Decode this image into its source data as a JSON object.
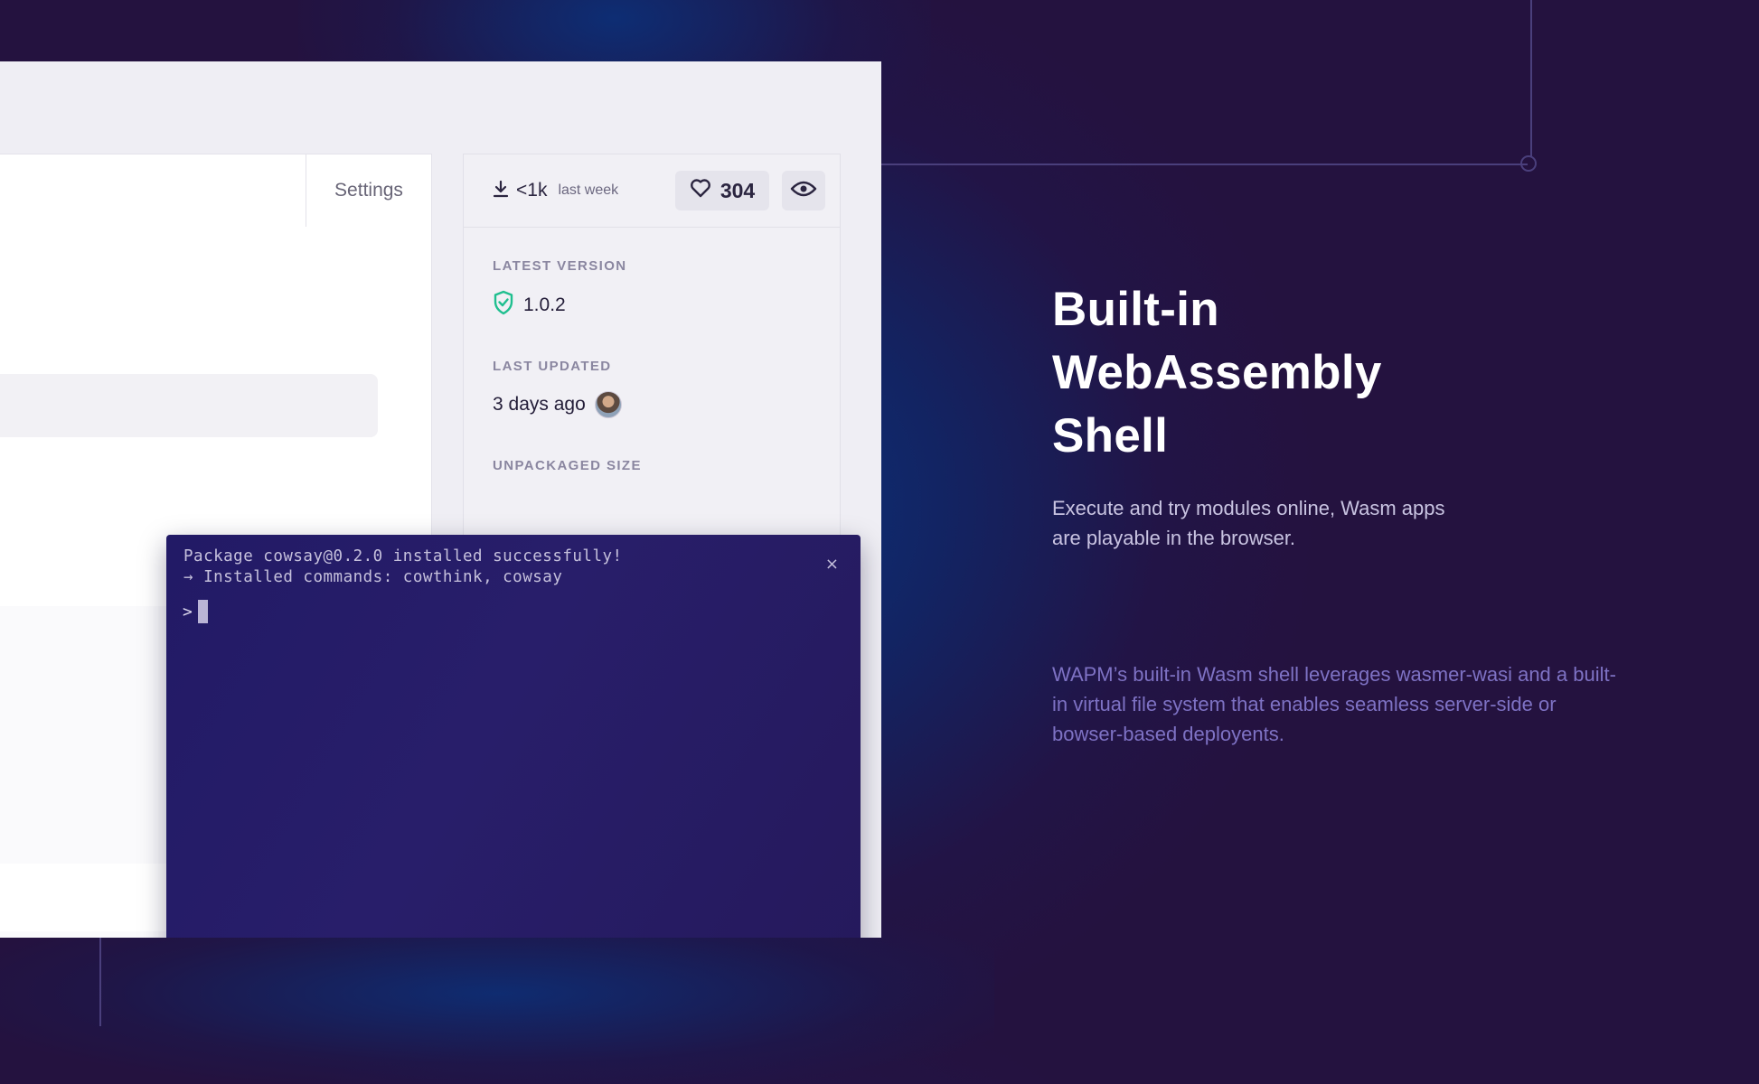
{
  "tabs": {
    "settings_label": "Settings"
  },
  "stats": {
    "downloads_count": "<1k",
    "downloads_period": "last week",
    "likes_count": "304"
  },
  "meta": {
    "latest_version_label": "LATEST VERSION",
    "latest_version_value": "1.0.2",
    "last_updated_label": "LAST UPDATED",
    "last_updated_value": "3 days ago",
    "unpackaged_size_label": "UNPACKAGED SIZE"
  },
  "terminal": {
    "line1": "Package cowsay@0.2.0 installed successfully!",
    "line2": "→ Installed commands: cowthink, cowsay",
    "prompt_symbol": ">",
    "close_symbol": "×"
  },
  "hero": {
    "title_line1": "Built-in",
    "title_line2": "WebAssembly",
    "title_line3": "Shell",
    "description": "Execute and try modules online, Wasm apps are  playable in the browser.",
    "note": "WAPM’s built-in Wasm shell leverages wasmer-wasi and a built-in virtual file system that enables seamless server-side or bowser-based deployents."
  },
  "icons": {
    "download": "download-icon",
    "heart": "heart-icon",
    "eye": "eye-icon",
    "shield": "shield-check-icon",
    "close": "close-icon"
  },
  "colors": {
    "background": "#24123f",
    "glow": "#0a3683",
    "terminal": "#231b66",
    "shield_green": "#1fbf8f",
    "hero_note": "#7e72c4"
  }
}
